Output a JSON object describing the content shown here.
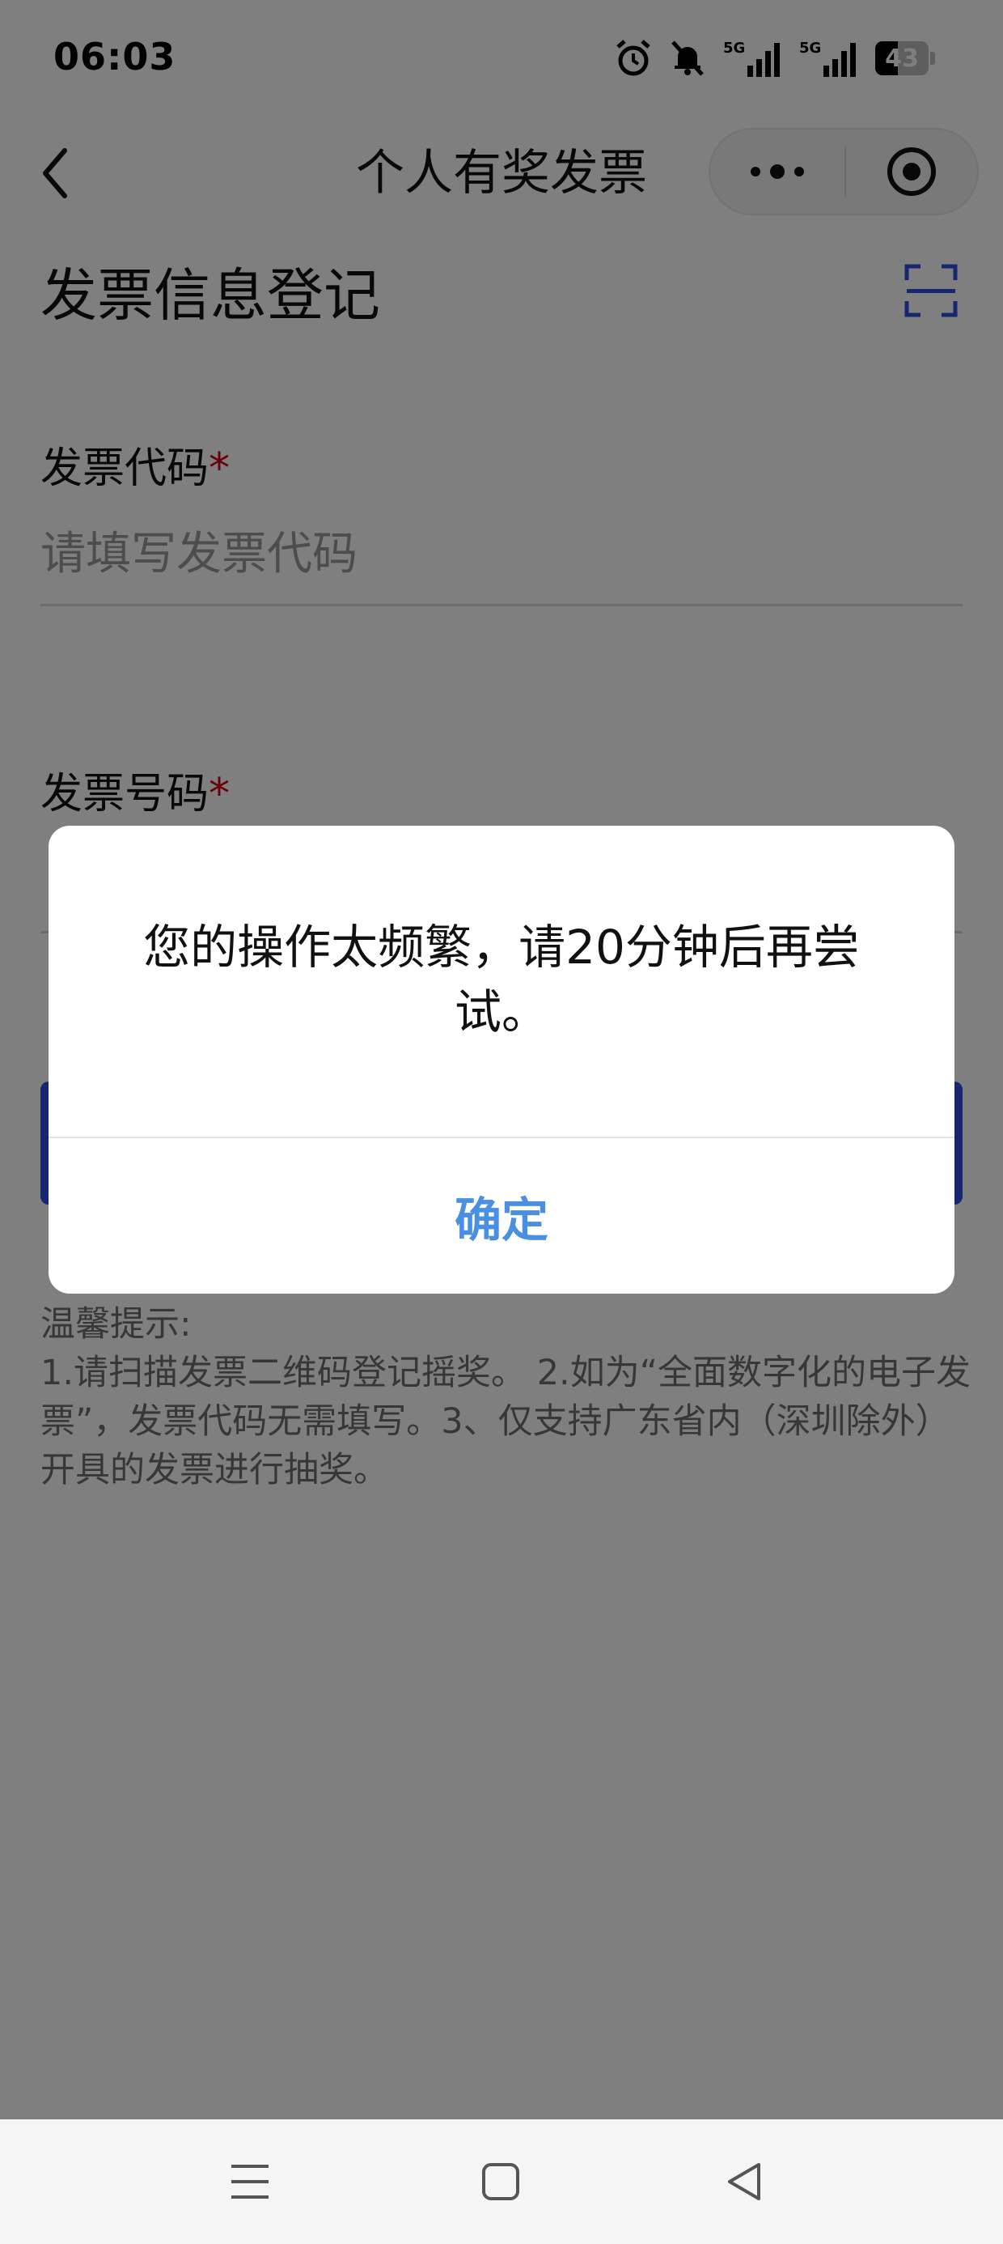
{
  "status_bar": {
    "time": "06:03",
    "battery": "43",
    "signal_1_label": "5G",
    "signal_2_label": "5G"
  },
  "nav": {
    "title": "个人有奖发票"
  },
  "form": {
    "section_title": "发票信息登记",
    "code_label": "发票代码",
    "code_required": "*",
    "code_placeholder": "请填写发票代码",
    "number_label": "发票号码",
    "number_required": "*",
    "submit_label": ""
  },
  "tips": {
    "title": "温馨提示:",
    "body": "1.请扫描发票二维码登记摇奖。 2.如为“全面数字化的电子发票”，发票代码无需填写。3、仅支持广东省内（深圳除外）开具的发票进行抽奖。"
  },
  "dialog": {
    "message": "您的操作太频繁，请20分钟后再尝试。",
    "confirm_label": "确定"
  },
  "colors": {
    "accent": "#2c4fe0",
    "dialog_button": "#4a90e2",
    "required": "#d0021b"
  },
  "icons": {
    "back": "chevron-left-icon",
    "more": "more-dots-icon",
    "close": "target-close-icon",
    "scan": "scan-icon",
    "menu": "menu-icon",
    "home": "home-square-icon",
    "sys_back": "triangle-back-icon"
  }
}
